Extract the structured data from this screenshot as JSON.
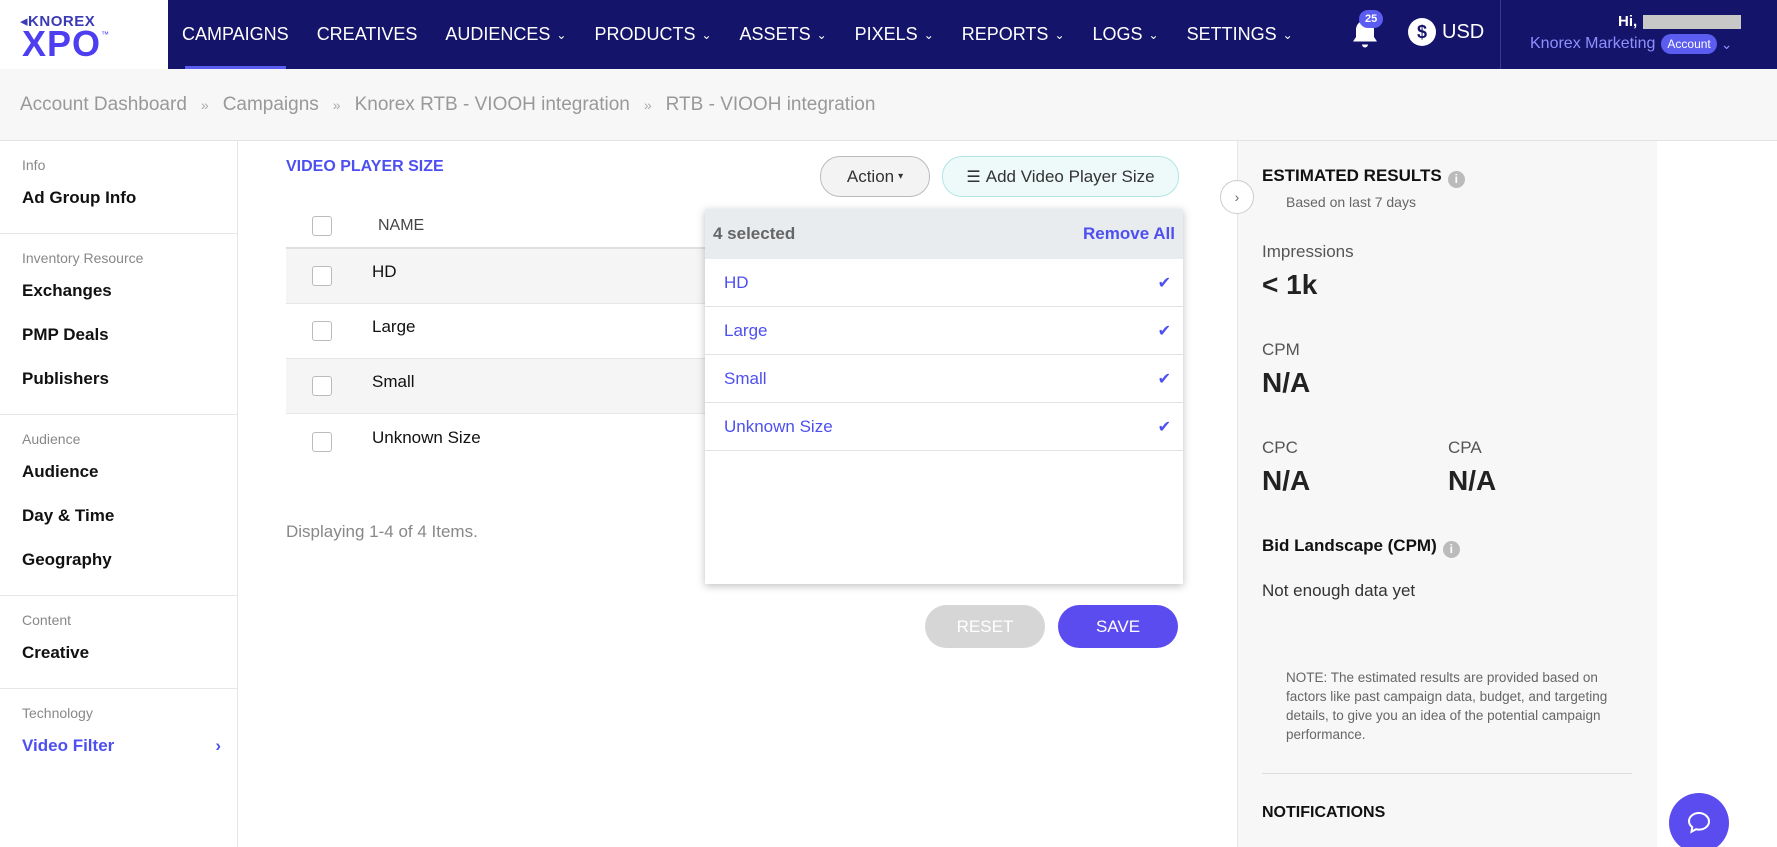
{
  "brand": {
    "small": "KNOREX",
    "big": "XPO",
    "tm": "™"
  },
  "nav": {
    "items": [
      {
        "label": "CAMPAIGNS",
        "chevron": false,
        "active": true
      },
      {
        "label": "CREATIVES",
        "chevron": false
      },
      {
        "label": "AUDIENCES",
        "chevron": true
      },
      {
        "label": "PRODUCTS",
        "chevron": true
      },
      {
        "label": "ASSETS",
        "chevron": true
      },
      {
        "label": "PIXELS",
        "chevron": true
      },
      {
        "label": "REPORTS",
        "chevron": true
      },
      {
        "label": "LOGS",
        "chevron": true
      },
      {
        "label": "SETTINGS",
        "chevron": true
      }
    ],
    "notification_count": "25",
    "currency": "USD",
    "currency_symbol": "$",
    "greeting": "Hi,",
    "account_name": "Knorex Marketing",
    "account_badge": "Account"
  },
  "breadcrumb": [
    "Account Dashboard",
    "Campaigns",
    "Knorex RTB - VIOOH integration",
    "RTB - VIOOH integration"
  ],
  "sidebar": {
    "groups": [
      {
        "label": "Info",
        "items": [
          "Ad Group Info"
        ]
      },
      {
        "label": "Inventory Resource",
        "items": [
          "Exchanges",
          "PMP Deals",
          "Publishers"
        ]
      },
      {
        "label": "Audience",
        "items": [
          "Audience",
          "Day & Time",
          "Geography"
        ]
      },
      {
        "label": "Content",
        "items": [
          "Creative"
        ]
      },
      {
        "label": "Technology",
        "items": [
          "Video Filter"
        ]
      }
    ]
  },
  "main": {
    "title": "VIDEO PLAYER SIZE",
    "action_label": "Action",
    "add_label": "Add Video Player Size",
    "column_name": "NAME",
    "rows": [
      "HD",
      "Large",
      "Small",
      "Unknown Size"
    ],
    "display_info": "Displaying 1-4 of 4 Items.",
    "reset_label": "RESET",
    "save_label": "SAVE"
  },
  "dropdown": {
    "selected_count": "4 selected",
    "remove_all": "Remove All",
    "items": [
      "HD",
      "Large",
      "Small",
      "Unknown Size"
    ]
  },
  "estimates": {
    "title": "ESTIMATED RESULTS",
    "subtitle": "Based on last 7 days",
    "impressions_label": "Impressions",
    "impressions_value": "< 1k",
    "cpm_label": "CPM",
    "cpm_value": "N/A",
    "cpc_label": "CPC",
    "cpc_value": "N/A",
    "cpa_label": "CPA",
    "cpa_value": "N/A",
    "bid_title": "Bid Landscape (CPM)",
    "bid_text": "Not enough data yet",
    "note": "NOTE: The estimated results are provided based on factors like past campaign data, budget, and targeting details, to give you an idea of the potential campaign performance.",
    "notifications_title": "NOTIFICATIONS"
  }
}
